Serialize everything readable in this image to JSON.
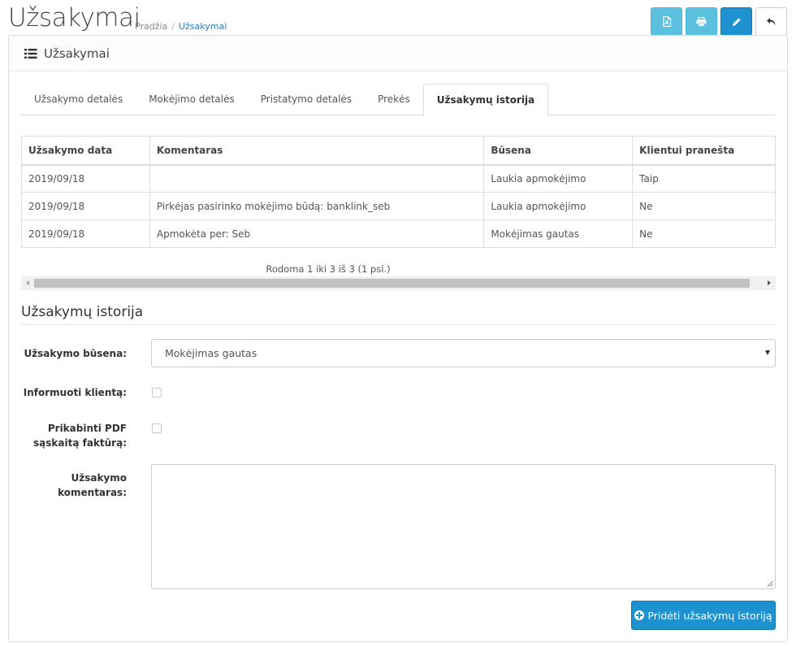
{
  "page": {
    "title": "Užsakymai",
    "breadcrumb": [
      "Pradžia",
      "Užsakymai"
    ],
    "actions": [
      {
        "name": "pdf-invoice-button",
        "icon": "file-pdf-icon"
      },
      {
        "name": "print-button",
        "icon": "print-icon"
      },
      {
        "name": "edit-button",
        "icon": "pencil-icon"
      },
      {
        "name": "back-button",
        "icon": "reply-icon"
      }
    ]
  },
  "panel": {
    "title": "Užsakymai",
    "icon": "list-icon"
  },
  "tabs": [
    {
      "label": "Užsakymo detalės"
    },
    {
      "label": "Mokėjimo detalės"
    },
    {
      "label": "Pristatymo detalės"
    },
    {
      "label": "Prekės"
    },
    {
      "label": "Užsakymų istorija",
      "active": true
    }
  ],
  "history_table": {
    "headers": [
      "Užsakymo data",
      "Komentaras",
      "Būsena",
      "Klientui pranešta"
    ],
    "rows": [
      [
        "2019/09/18",
        "",
        "Laukia apmokėjimo",
        "Taip"
      ],
      [
        "2019/09/18",
        "Pirkėjas pasirinko mokėjimo būdą: banklink_seb",
        "Laukia apmokėjimo",
        "Ne"
      ],
      [
        "2019/09/18",
        "Apmokėta per: Seb",
        "Mokėjimas gautas",
        "Ne"
      ]
    ],
    "pagination": "Rodoma 1 iki 3 iš 3 (1 psl.)"
  },
  "form": {
    "legend": "Užsakymų istorija",
    "status_label": "Užsakymo būsena:",
    "status_value": "Mokėjimas gautas",
    "notify_label": "Informuoti klientą:",
    "notify_checked": false,
    "attach_pdf_label_1": "Prikabinti PDF",
    "attach_pdf_label_2": "sąskaitą faktūrą:",
    "attach_pdf_checked": false,
    "comment_label_1": "Užsakymo",
    "comment_label_2": "komentaras:",
    "comment_value": "",
    "submit_label": "Pridėti užsakymų istoriją"
  },
  "colors": {
    "primary": "#1e91cf",
    "info": "#5bc0de",
    "link": "#1e7fc4"
  }
}
